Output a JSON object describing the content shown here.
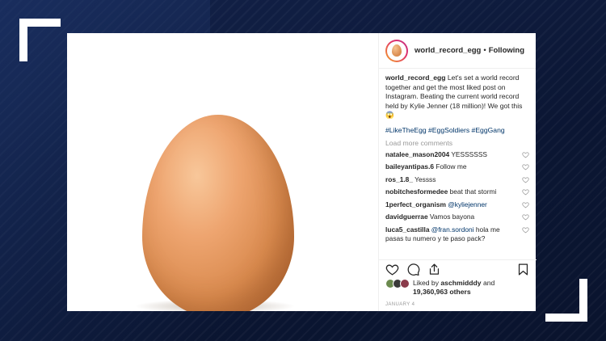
{
  "post": {
    "username": "world_record_egg",
    "separator": "•",
    "follow_status": "Following",
    "caption_user": "world_record_egg",
    "caption_text": " Let's set a world record together and get the most liked post on Instagram. Beating the current world record held by Kylie Jenner (18 million)! We got this 😱",
    "hashtags": "#LikeTheEgg #EggSoldiers #EggGang",
    "load_more": "Load more comments",
    "comments": [
      {
        "user": "natalee_mason2004",
        "text": " YESSSSSS",
        "mention": ""
      },
      {
        "user": "baileyantipas.6",
        "text": " Follow me",
        "mention": ""
      },
      {
        "user": "ros_1.8_",
        "text": " Yessss",
        "mention": ""
      },
      {
        "user": "nobitchesformedee",
        "text": " beat that stormi",
        "mention": ""
      },
      {
        "user": "1perfect_organism",
        "text": "",
        "mention": " @kyliejenner"
      },
      {
        "user": "davidguerrae",
        "text": " Vamos bayona",
        "mention": ""
      },
      {
        "user": "luca5_castilla",
        "text": " hola me pasas tu numero y te paso pack?",
        "mention": " @fran.sordoni"
      }
    ],
    "liked_prefix": "Liked by ",
    "liked_user": "aschmidddy",
    "liked_and": " and",
    "liked_count": "19,360,963 others",
    "date": "JANUARY 4"
  },
  "icons": [
    "heart-icon",
    "comment-icon",
    "share-icon",
    "bookmark-icon"
  ],
  "colors": {
    "background": "#0e1a3a",
    "link": "#003569",
    "muted": "#999999",
    "egg": "#d98a4e"
  }
}
